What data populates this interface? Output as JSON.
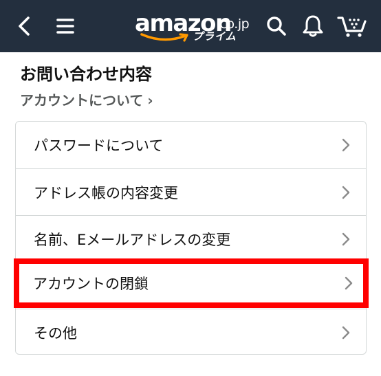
{
  "header": {
    "back_icon": "back-chevron-icon",
    "menu_icon": "hamburger-menu-icon",
    "logo": {
      "word": "amazon",
      "tld": ".co.jp",
      "sub": "プライム"
    },
    "search_icon": "search-icon",
    "bell_icon": "notification-bell-icon",
    "cart_icon": "cart-icon",
    "bar_color": "#232f3e",
    "smile_color": "#ff9900"
  },
  "page": {
    "title": "お問い合わせ内容",
    "breadcrumb": "アカウントについて",
    "breadcrumb_chevron": "›"
  },
  "options": [
    {
      "label": "パスワードについて"
    },
    {
      "label": "アドレス帳の内容変更"
    },
    {
      "label": "名前、Eメールアドレスの変更"
    },
    {
      "label": "アカウントの閉鎖",
      "highlighted": true
    },
    {
      "label": "その他"
    }
  ],
  "highlight_color": "#ff0000"
}
